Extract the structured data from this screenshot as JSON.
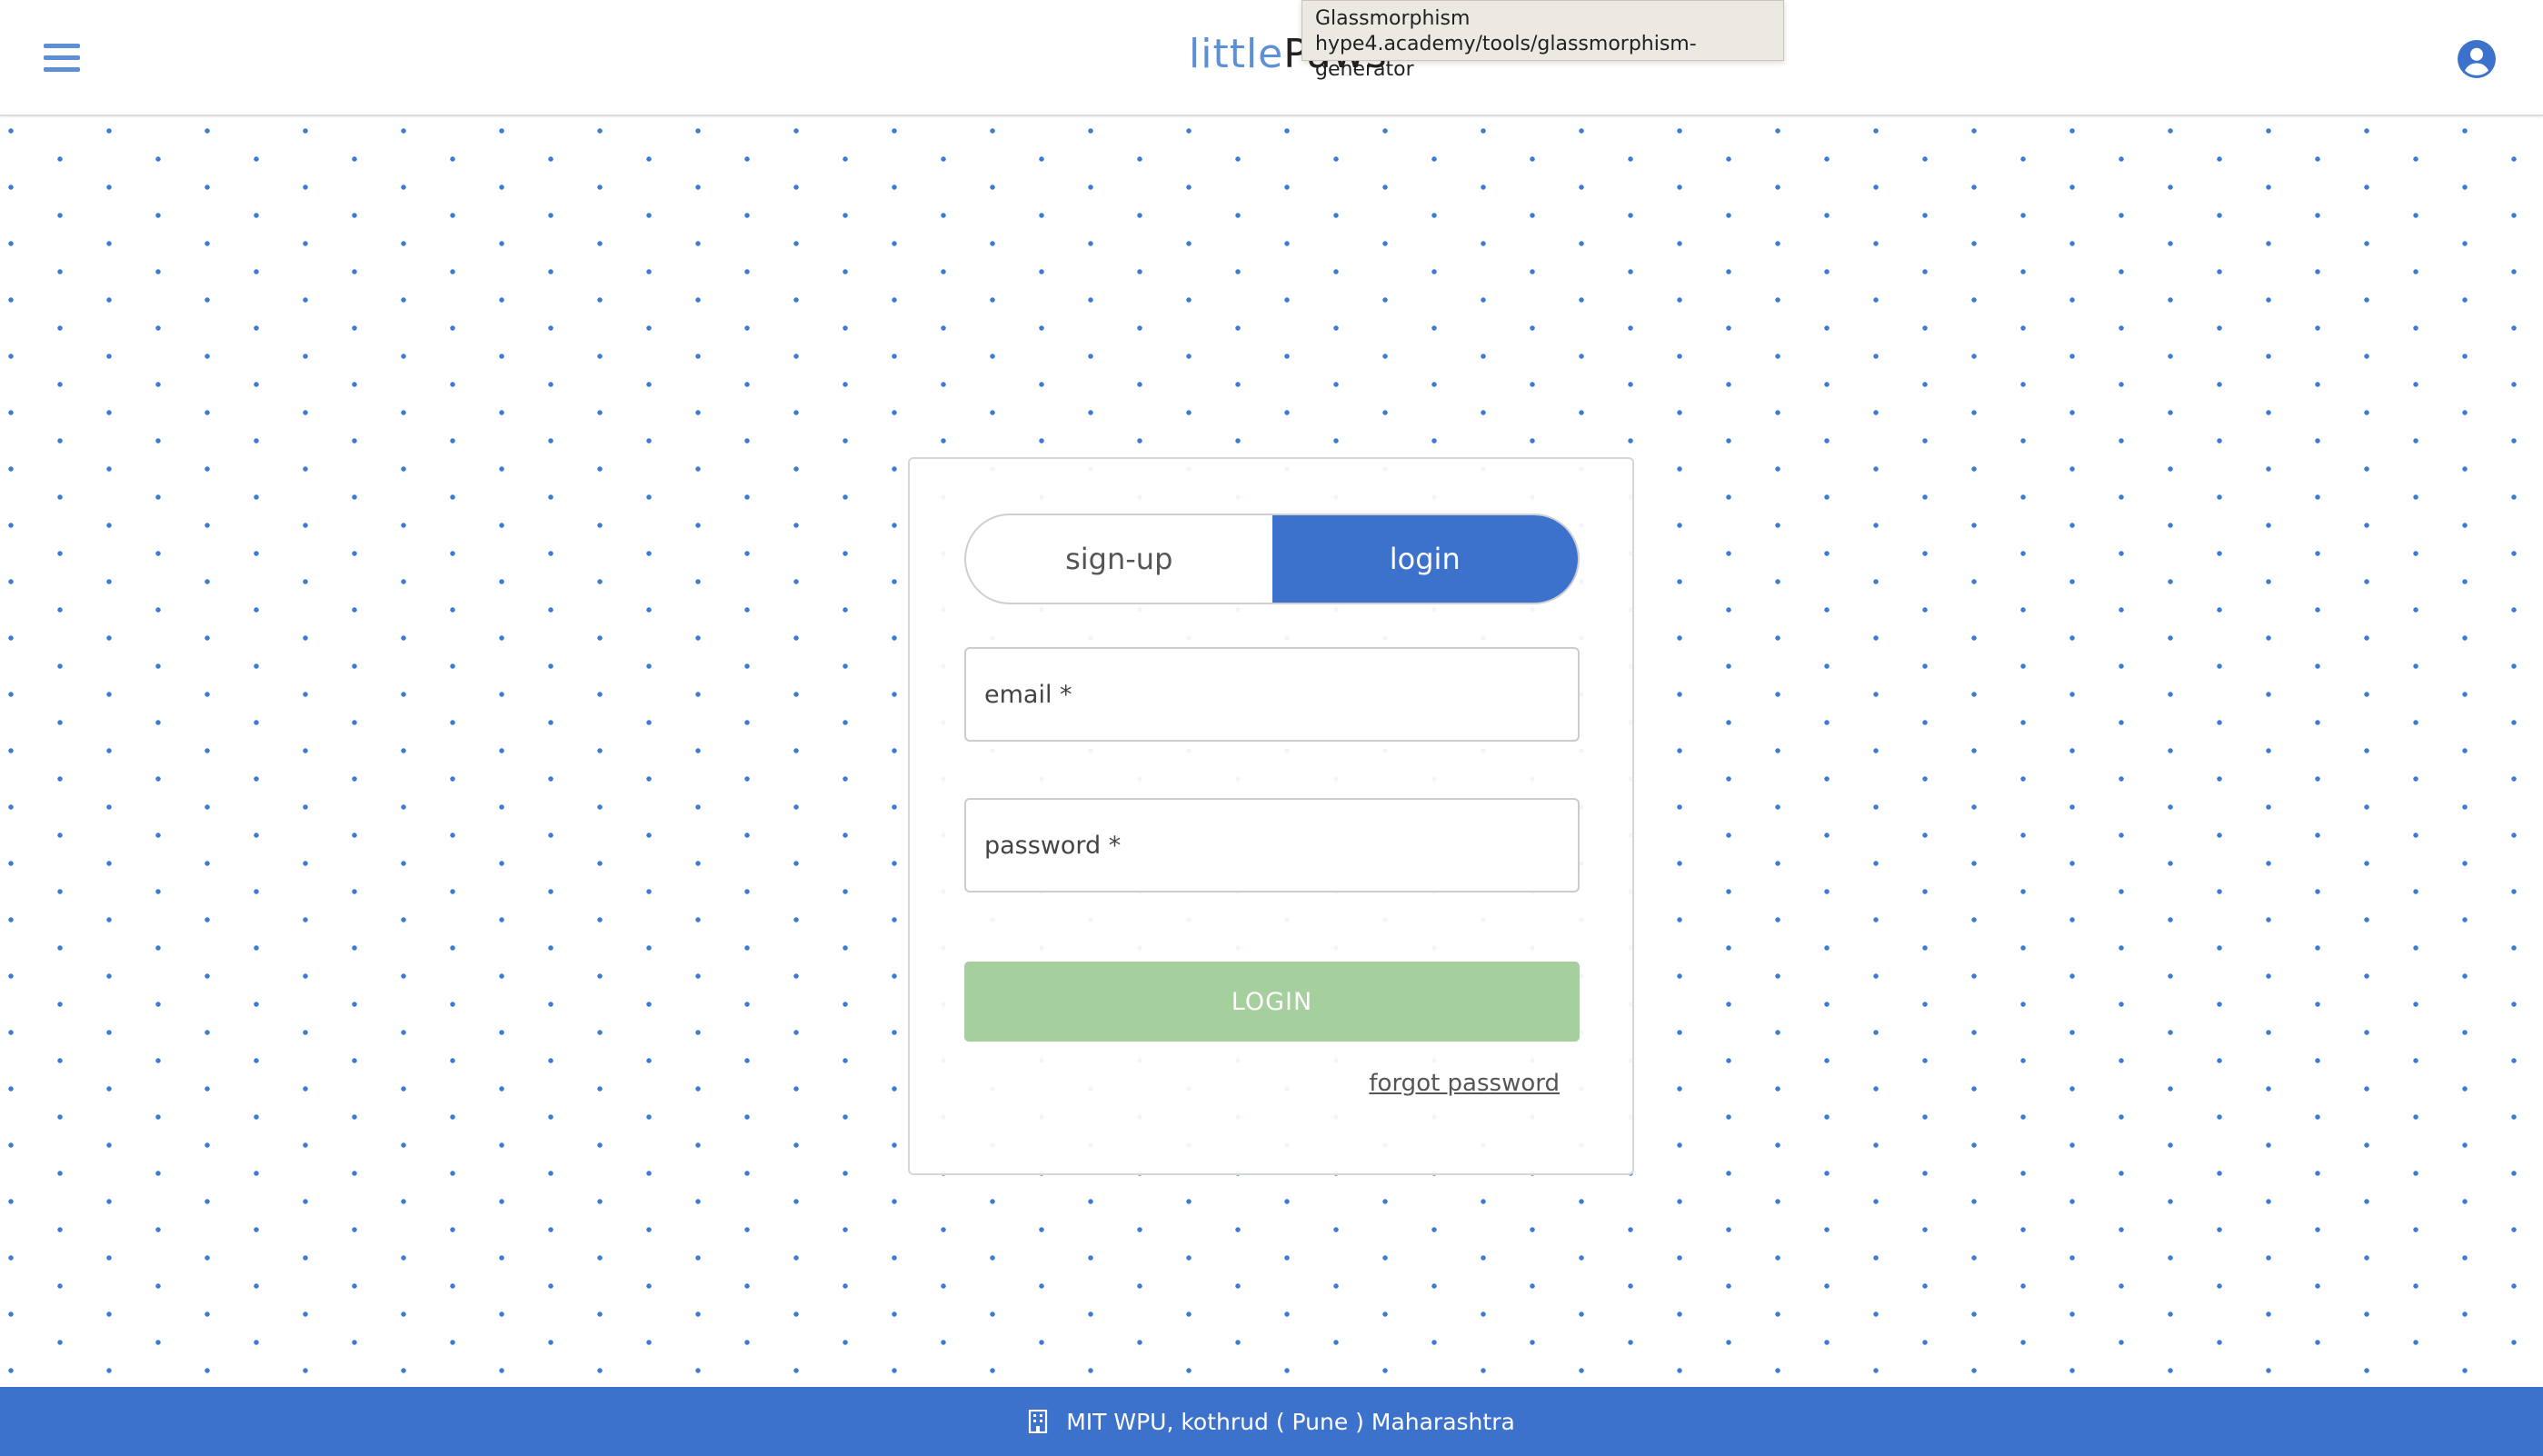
{
  "tooltip": {
    "title": "Glassmorphism",
    "url": "hype4.academy/tools/glassmorphism-generator"
  },
  "header": {
    "brand_part1": "little",
    "brand_part2": "Paws",
    "menu_icon": "hamburger-menu-icon",
    "account_icon": "account-circle-icon"
  },
  "auth": {
    "tabs": [
      {
        "label": "sign-up",
        "active": false
      },
      {
        "label": "login",
        "active": true
      }
    ],
    "email_placeholder": "email *",
    "password_placeholder": "password *",
    "submit_label": "LOGIN",
    "forgot_label": "forgot password"
  },
  "footer": {
    "icon": "building-icon",
    "address": "MIT WPU, kothrud ( Pune ) Maharashtra"
  },
  "colors": {
    "accent": "#3d72cc",
    "brand_light": "#5b8fd8",
    "login_button": "#a5cf9c",
    "dot_pattern": "#3b7bd4"
  }
}
